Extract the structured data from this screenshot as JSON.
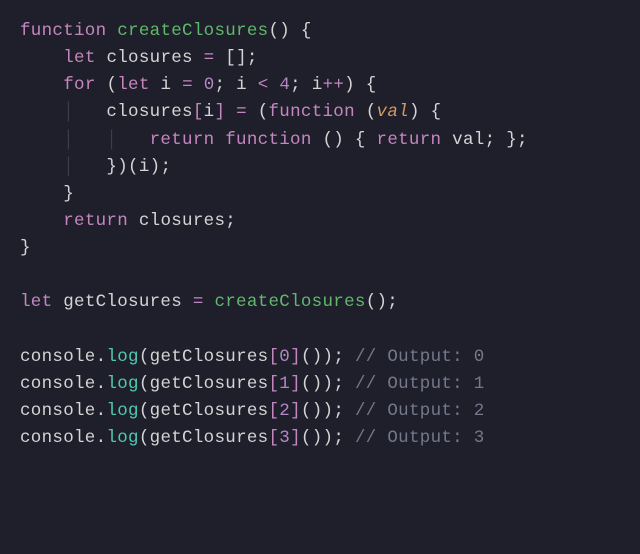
{
  "code": {
    "l1": {
      "fn_kw": "function",
      "fn_name": "createClosures",
      "lp": "()",
      "sp": " ",
      "ob": "{"
    },
    "l2": {
      "indent": "    ",
      "let": "let",
      "sp": " ",
      "id": "closures",
      "eq": " = ",
      "empty": "[]",
      "semi": ";"
    },
    "l3": {
      "indent": "    ",
      "for": "for",
      "sp": " ",
      "lp": "(",
      "let": "let",
      "sp2": " ",
      "i": "i",
      "eq": " = ",
      "zero": "0",
      "semi1": "; ",
      "i2": "i",
      "lt": " < ",
      "four": "4",
      "semi2": "; ",
      "i3": "i",
      "inc": "++",
      "rp": ")",
      "sp3": " ",
      "ob": "{"
    },
    "l4": {
      "indent": "        ",
      "id": "closures",
      "lb": "[",
      "i": "i",
      "rb": "]",
      "eq": " = ",
      "lp": "(",
      "fn_kw": "function",
      "sp": " ",
      "lp2": "(",
      "val": "val",
      "rp2": ")",
      "sp2": " ",
      "ob": "{"
    },
    "l5": {
      "indent": "            ",
      "ret": "return",
      "sp": " ",
      "fn_kw": "function",
      "sp2": " ",
      "lp": "()",
      "sp3": " ",
      "ob": "{",
      "sp4": " ",
      "ret2": "return",
      "sp5": " ",
      "val": "val",
      "semi": ";",
      "sp6": " ",
      "cb": "}",
      "semi2": ";"
    },
    "l6": {
      "indent": "        ",
      "cb": "}",
      "rp": ")",
      "lp": "(",
      "i": "i",
      "rp2": ")",
      "semi": ";"
    },
    "l7": {
      "indent": "    ",
      "cb": "}"
    },
    "l8": {
      "indent": "    ",
      "ret": "return",
      "sp": " ",
      "id": "closures",
      "semi": ";"
    },
    "l9": {
      "cb": "}"
    },
    "l10": "",
    "l11": {
      "let": "let",
      "sp": " ",
      "id": "getClosures",
      "eq": " = ",
      "fn": "createClosures",
      "lp": "()",
      "semi": ";"
    },
    "l12": "",
    "calls": [
      {
        "console": "console",
        "dot": ".",
        "log": "log",
        "lp": "(",
        "id": "getClosures",
        "lb": "[",
        "n": "0",
        "rb": "]",
        "call": "()",
        "rp": ")",
        "semi": ";",
        "sp": " ",
        "comment": "// Output: 0"
      },
      {
        "console": "console",
        "dot": ".",
        "log": "log",
        "lp": "(",
        "id": "getClosures",
        "lb": "[",
        "n": "1",
        "rb": "]",
        "call": "()",
        "rp": ")",
        "semi": ";",
        "sp": " ",
        "comment": "// Output: 1"
      },
      {
        "console": "console",
        "dot": ".",
        "log": "log",
        "lp": "(",
        "id": "getClosures",
        "lb": "[",
        "n": "2",
        "rb": "]",
        "call": "()",
        "rp": ")",
        "semi": ";",
        "sp": " ",
        "comment": "// Output: 2"
      },
      {
        "console": "console",
        "dot": ".",
        "log": "log",
        "lp": "(",
        "id": "getClosures",
        "lb": "[",
        "n": "3",
        "rb": "]",
        "call": "()",
        "rp": ")",
        "semi": ";",
        "sp": " ",
        "comment": "// Output: 3"
      }
    ]
  }
}
